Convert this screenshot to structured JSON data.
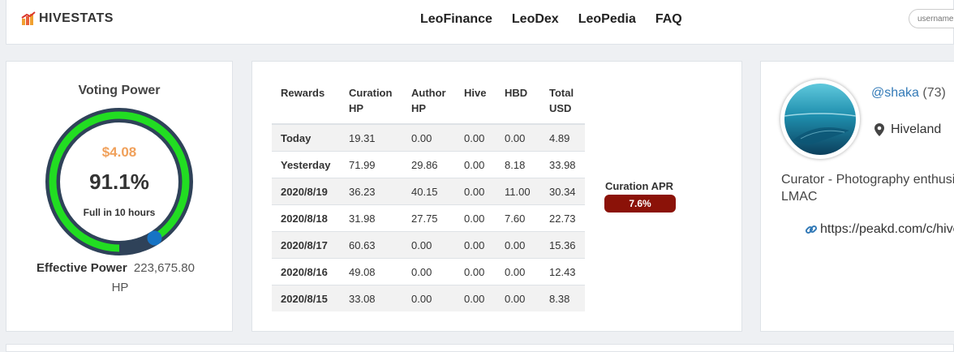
{
  "nav": {
    "brand": "HIVESTATS",
    "links": [
      "LeoFinance",
      "LeoDex",
      "LeoPedia",
      "FAQ"
    ],
    "search_placeholder": "username"
  },
  "voting": {
    "title": "Voting Power",
    "usd": "$4.08",
    "percent": "91.1%",
    "percent_value": 91.1,
    "full_in": "Full in 10 hours",
    "effective_label": "Effective Power",
    "effective_value": "223,675.80",
    "effective_unit": "HP",
    "colors": {
      "ring_bg": "#2f4259",
      "ring_fill": "#22dd22",
      "knob": "#1673c4"
    }
  },
  "rewards": {
    "headers": [
      "Rewards",
      "Curation HP",
      "Author HP",
      "Hive",
      "HBD",
      "Total USD"
    ],
    "rows": [
      [
        "Today",
        "19.31",
        "0.00",
        "0.00",
        "0.00",
        "4.89"
      ],
      [
        "Yesterday",
        "71.99",
        "29.86",
        "0.00",
        "8.18",
        "33.98"
      ],
      [
        "2020/8/19",
        "36.23",
        "40.15",
        "0.00",
        "11.00",
        "30.34"
      ],
      [
        "2020/8/18",
        "31.98",
        "27.75",
        "0.00",
        "7.60",
        "22.73"
      ],
      [
        "2020/8/17",
        "60.63",
        "0.00",
        "0.00",
        "0.00",
        "15.36"
      ],
      [
        "2020/8/16",
        "49.08",
        "0.00",
        "0.00",
        "0.00",
        "12.43"
      ],
      [
        "2020/8/15",
        "33.08",
        "0.00",
        "0.00",
        "0.00",
        "8.38"
      ]
    ],
    "apr_label": "Curation APR",
    "apr_value": "7.6%",
    "apr_color": "#8b1208"
  },
  "profile": {
    "username": "@shaka",
    "reputation": "(73)",
    "location": "Hiveland",
    "bio_line1": "Curator - Photography enthusi",
    "bio_line2": "LMAC",
    "website": "https://peakd.com/c/hive",
    "icons": [
      "map-marker-icon",
      "link-icon"
    ]
  }
}
